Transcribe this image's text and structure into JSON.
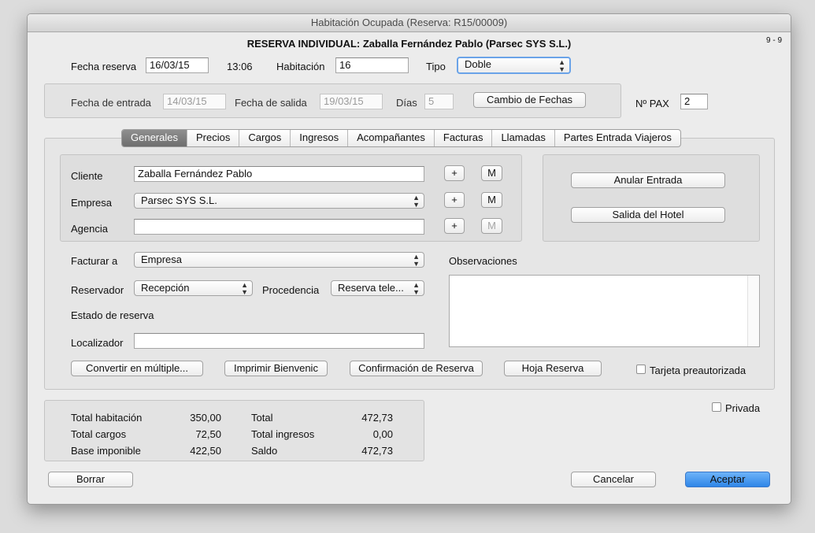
{
  "window": {
    "title": "Habitación Ocupada (Reserva: R15/00009)",
    "heading": "RESERVA INDIVIDUAL: Zaballa Fernández Pablo (Parsec SYS S.L.)",
    "record_counter": "9 - 9"
  },
  "reserva": {
    "fecha_label": "Fecha reserva",
    "fecha_value": "16/03/15",
    "hora": "13:06",
    "habitacion_label": "Habitación",
    "habitacion_value": "16",
    "tipo_label": "Tipo",
    "tipo_value": "Doble"
  },
  "fechas": {
    "entrada_label": "Fecha de entrada",
    "entrada_value": "14/03/15",
    "salida_label": "Fecha de salida",
    "salida_value": "19/03/15",
    "dias_label": "Días",
    "dias_value": "5",
    "cambio_button": "Cambio de Fechas",
    "pax_label": "Nº PAX",
    "pax_value": "2"
  },
  "tabs": [
    {
      "label": "Generales",
      "active": true
    },
    {
      "label": "Precios"
    },
    {
      "label": "Cargos"
    },
    {
      "label": "Ingresos"
    },
    {
      "label": "Acompañantes"
    },
    {
      "label": "Facturas"
    },
    {
      "label": "Llamadas"
    },
    {
      "label": "Partes Entrada Viajeros"
    }
  ],
  "cliente": {
    "cliente_label": "Cliente",
    "cliente_value": "Zaballa Fernández Pablo",
    "empresa_label": "Empresa",
    "empresa_value": "Parsec SYS S.L.",
    "agencia_label": "Agencia",
    "agencia_value": "",
    "plus": "+",
    "m": "M"
  },
  "acciones": {
    "anular": "Anular Entrada",
    "salida": "Salida del Hotel"
  },
  "facturacion": {
    "facturar_label": "Facturar a",
    "facturar_value": "Empresa",
    "reservador_label": "Reservador",
    "reservador_value": "Recepción",
    "procedencia_label": "Procedencia",
    "procedencia_value": "Reserva tele...",
    "estado_label": "Estado de reserva",
    "localizador_label": "Localizador",
    "localizador_value": "",
    "observaciones_label": "Observaciones"
  },
  "bottom_buttons": {
    "convertir": "Convertir en múltiple...",
    "imprimir": "Imprimir Bienvenic",
    "confirmacion": "Confirmación de Reserva",
    "hoja": "Hoja Reserva",
    "tarjeta": "Tarjeta preautorizada",
    "privada": "Privada"
  },
  "totales": {
    "total_habitacion_label": "Total habitación",
    "total_habitacion": "350,00",
    "total_cargos_label": "Total cargos",
    "total_cargos": "72,50",
    "base_label": "Base imponible",
    "base": "422,50",
    "total_label": "Total",
    "total": "472,73",
    "ingresos_label": "Total ingresos",
    "ingresos": "0,00",
    "saldo_label": "Saldo",
    "saldo": "472,73"
  },
  "footer": {
    "borrar": "Borrar",
    "cancelar": "Cancelar",
    "aceptar": "Aceptar"
  }
}
